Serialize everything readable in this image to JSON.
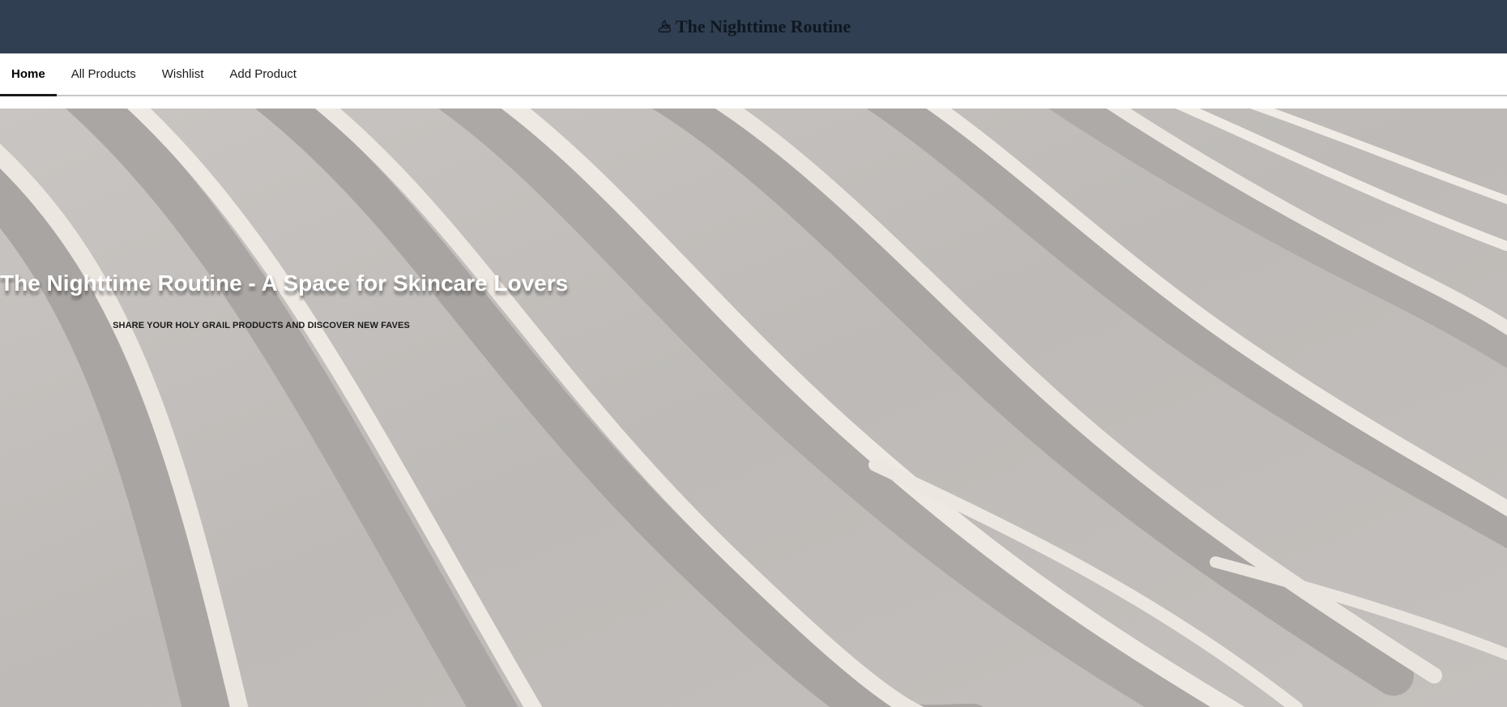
{
  "header": {
    "title": "The Nighttime Routine",
    "icon": "cloud-moon-icon"
  },
  "nav": {
    "items": [
      {
        "label": "Home",
        "active": true
      },
      {
        "label": "All Products",
        "active": false
      },
      {
        "label": "Wishlist",
        "active": false
      },
      {
        "label": "Add Product",
        "active": false
      }
    ]
  },
  "hero": {
    "title": "The Nighttime Routine - A Space for Skincare Lovers",
    "subtitle": "SHARE YOUR HOLY GRAIL PRODUCTS AND DISCOVER NEW FAVES",
    "background": "sand-dunes-image"
  },
  "colors": {
    "header_bg": "#303f52",
    "nav_bg": "#ffffff",
    "active_underline": "#1a1a1a",
    "sand_light": "#ece6e1",
    "sand_shadow": "#a7a3a0"
  }
}
